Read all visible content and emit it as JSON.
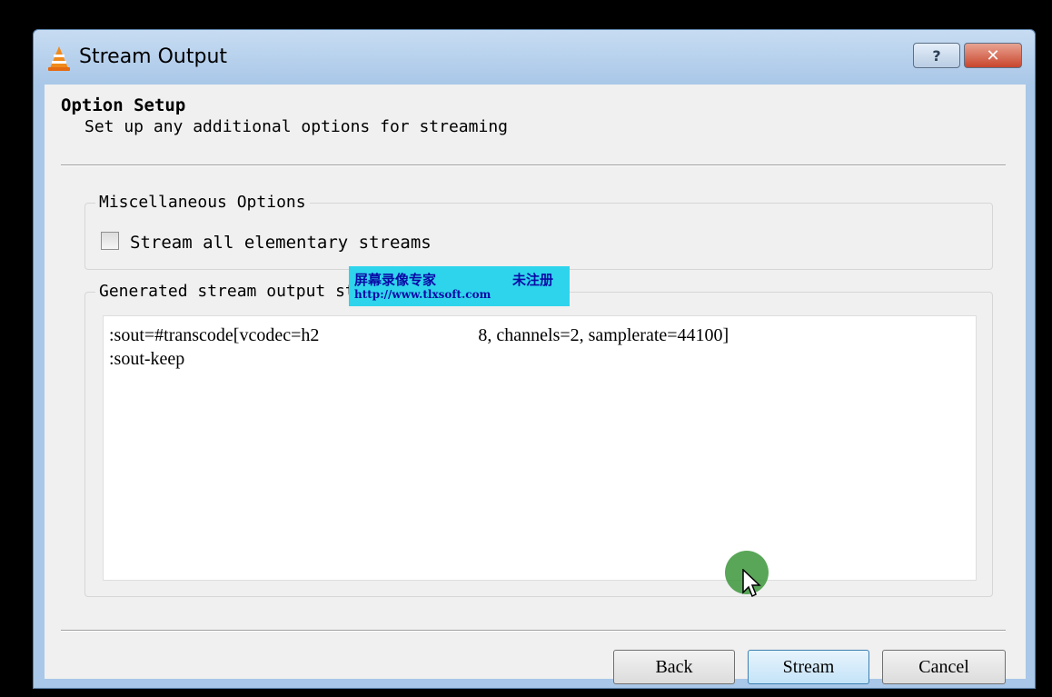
{
  "window": {
    "title": "Stream Output",
    "help_label": "?",
    "close_label": "✕"
  },
  "page": {
    "title": "Option Setup",
    "subtitle": "Set up any additional options for streaming"
  },
  "misc_group": {
    "label": "Miscellaneous Options",
    "checkbox_label": "Stream all elementary streams",
    "checked": false
  },
  "output_group": {
    "label": "Generated stream output string",
    "line1": ":sout=#transcode[vcodec=h2                                   8, channels=2, samplerate=44100]",
    "line2": ":sout-keep"
  },
  "watermark": {
    "left_text": "屏幕录像专家",
    "right_text": "未注册",
    "url": "http://www.tlxsoft.com"
  },
  "buttons": {
    "back": "Back",
    "stream": "Stream",
    "cancel": "Cancel"
  },
  "colors": {
    "title_bar": "#a9c7e8",
    "close_button": "#c9452c",
    "watermark_bg": "#2ed4ec",
    "hover_button": "#c4e3f8"
  }
}
